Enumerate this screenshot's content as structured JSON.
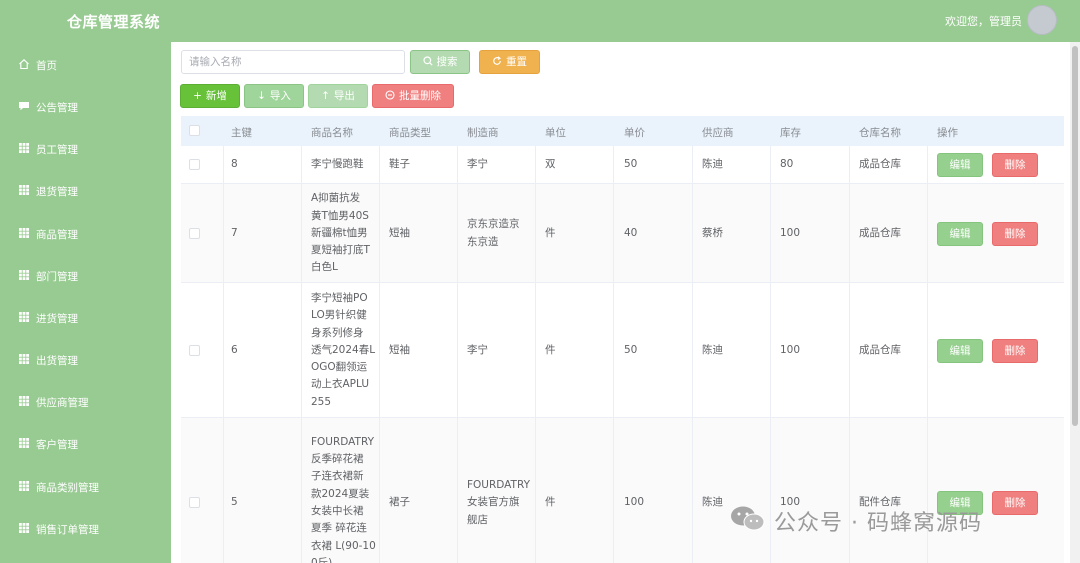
{
  "app": {
    "title": "仓库管理系统",
    "welcome": "欢迎您，管理员"
  },
  "sidebar": {
    "items": [
      {
        "label": "首页",
        "icon": "home-icon"
      },
      {
        "label": "公告管理",
        "icon": "message-icon"
      },
      {
        "label": "员工管理",
        "icon": "grid-icon"
      },
      {
        "label": "退货管理",
        "icon": "grid-icon"
      },
      {
        "label": "商品管理",
        "icon": "grid-icon"
      },
      {
        "label": "部门管理",
        "icon": "grid-icon"
      },
      {
        "label": "进货管理",
        "icon": "grid-icon"
      },
      {
        "label": "出货管理",
        "icon": "grid-icon"
      },
      {
        "label": "供应商管理",
        "icon": "grid-icon"
      },
      {
        "label": "客户管理",
        "icon": "grid-icon"
      },
      {
        "label": "商品类别管理",
        "icon": "grid-icon"
      },
      {
        "label": "销售订单管理",
        "icon": "grid-icon"
      }
    ]
  },
  "toolbar": {
    "search_placeholder": "请输入名称",
    "search_label": "搜索",
    "reset_label": "重置",
    "add_label": "新增",
    "import_label": "导入",
    "export_label": "导出",
    "batch_delete_label": "批量删除"
  },
  "table": {
    "headers": [
      "主键",
      "商品名称",
      "商品类型",
      "制造商",
      "单位",
      "单价",
      "供应商",
      "库存",
      "仓库名称",
      "操作"
    ],
    "edit_label": "编辑",
    "delete_label": "删除",
    "rows": [
      {
        "id": "8",
        "name_lines": [
          "李宁慢跑鞋"
        ],
        "type": "鞋子",
        "manufacturer_lines": [
          "李宁"
        ],
        "unit": "双",
        "price": "50",
        "supplier": "陈迪",
        "stock": "80",
        "warehouse": "成品仓库"
      },
      {
        "id": "7",
        "name_lines": [
          "A抑菌抗发",
          "黄T恤男40S",
          "新疆棉t恤男",
          "夏短袖打底T",
          "白色L"
        ],
        "type": "短袖",
        "manufacturer_lines": [
          "京东京造京",
          "东京造"
        ],
        "unit": "件",
        "price": "40",
        "supplier": "蔡桥",
        "stock": "100",
        "warehouse": "成品仓库"
      },
      {
        "id": "6",
        "name_lines": [
          "李宁短袖PO",
          "LO男针织健",
          "身系列修身",
          "透气2024春L",
          "OGO翻领运",
          "动上衣APLU",
          "255"
        ],
        "type": "短袖",
        "manufacturer_lines": [
          "李宁"
        ],
        "unit": "件",
        "price": "50",
        "supplier": "陈迪",
        "stock": "100",
        "warehouse": "成品仓库"
      },
      {
        "id": "5",
        "name_lines": [
          "FOURDATRY",
          "反季碎花裙",
          "子连衣裙新",
          "款2024夏装",
          "女装中长裙",
          "夏季 碎花连",
          "衣裙 L(90-10",
          "0斤)"
        ],
        "type": "裙子",
        "manufacturer_lines": [
          "FOURDATRY",
          "女装官方旗",
          "舰店"
        ],
        "unit": "件",
        "price": "100",
        "supplier": "陈迪",
        "stock": "100",
        "warehouse": "配件仓库"
      }
    ]
  },
  "watermark": {
    "text": "公众号 · 码蜂窝源码"
  },
  "colors": {
    "brand": "#98cb92",
    "primary": "#67c23a",
    "warning": "#e6a23c",
    "danger": "#f07f7f",
    "table_header": "#eaf3fb"
  }
}
